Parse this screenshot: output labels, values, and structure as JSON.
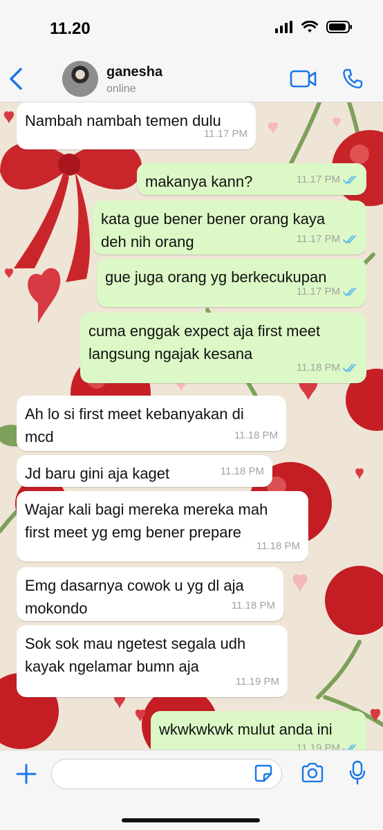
{
  "status_bar": {
    "time": "11.20"
  },
  "header": {
    "contact_name": "ganesha",
    "contact_status": "online",
    "back_icon": "chevron-left-icon",
    "video_icon": "video-camera-icon",
    "call_icon": "phone-icon"
  },
  "colors": {
    "accent": "#1877e6",
    "incoming_bubble": "#ffffff",
    "outgoing_bubble": "#dcf8c6",
    "read_ticks": "#4fb6ec",
    "timestamp": "#a3a3a3"
  },
  "messages": [
    {
      "direction": "in",
      "lines": [
        "Nambah nambah temen dulu"
      ],
      "time": "11.17 PM"
    },
    {
      "direction": "out",
      "lines": [
        "makanya kann?"
      ],
      "time": "11.17 PM",
      "read": true
    },
    {
      "direction": "out",
      "lines": [
        "kata gue bener bener orang kaya",
        "deh nih orang"
      ],
      "time": "11.17 PM",
      "read": true
    },
    {
      "direction": "out",
      "lines": [
        "gue juga orang yg berkecukupan"
      ],
      "time": "11.17 PM",
      "read": true
    },
    {
      "direction": "out",
      "lines": [
        "cuma enggak expect aja first meet",
        "langsung ngajak kesana"
      ],
      "time": "11.18 PM",
      "read": true
    },
    {
      "direction": "in",
      "lines": [
        "Ah lo si first meet kebanyakan di",
        "mcd"
      ],
      "time": "11.18 PM"
    },
    {
      "direction": "in",
      "lines": [
        "Jd baru gini aja kaget"
      ],
      "time": "11.18 PM"
    },
    {
      "direction": "in",
      "lines": [
        "Wajar kali bagi mereka mereka mah",
        "first meet yg emg bener prepare"
      ],
      "time": "11.18 PM"
    },
    {
      "direction": "in",
      "lines": [
        "Emg dasarnya cowok u yg dl aja",
        "mokondo"
      ],
      "time": "11.18 PM"
    },
    {
      "direction": "in",
      "lines": [
        "Sok sok mau ngetest segala udh",
        "kayak ngelamar bumn aja"
      ],
      "time": "11.19 PM"
    },
    {
      "direction": "out",
      "lines": [
        "wkwkwkwk mulut anda ini"
      ],
      "time": "11.19 PM",
      "read": true
    }
  ],
  "input_bar": {
    "placeholder": "",
    "plus_icon": "plus-icon",
    "sticker_icon": "sticker-icon",
    "camera_icon": "camera-icon",
    "mic_icon": "microphone-icon"
  }
}
